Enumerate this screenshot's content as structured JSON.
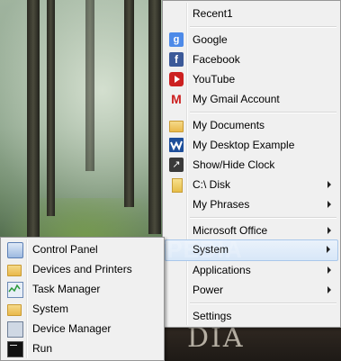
{
  "main_menu": {
    "items": [
      {
        "label": "Recent1",
        "icon": "",
        "submenu": false
      },
      {
        "label": "Google",
        "icon": "google-icon",
        "submenu": false
      },
      {
        "label": "Facebook",
        "icon": "facebook-icon",
        "submenu": false
      },
      {
        "label": "YouTube",
        "icon": "youtube-icon",
        "submenu": false
      },
      {
        "label": "My Gmail Account",
        "icon": "gmail-icon",
        "submenu": false
      },
      {
        "label": "My Documents",
        "icon": "folder-icon",
        "submenu": false
      },
      {
        "label": "My Desktop Example",
        "icon": "wave-icon",
        "submenu": false
      },
      {
        "label": "Show/Hide Clock",
        "icon": "shortcut-arrow-icon",
        "submenu": false
      },
      {
        "label": "C:\\ Disk",
        "icon": "disk-folder-icon",
        "submenu": true
      },
      {
        "label": "My Phrases",
        "icon": "",
        "submenu": true
      },
      {
        "label": "Microsoft Office",
        "icon": "",
        "submenu": true
      },
      {
        "label": "System",
        "icon": "",
        "submenu": true,
        "highlighted": true
      },
      {
        "label": "Applications",
        "icon": "",
        "submenu": true
      },
      {
        "label": "Power",
        "icon": "",
        "submenu": true
      },
      {
        "label": "Settings",
        "icon": "",
        "submenu": false
      }
    ]
  },
  "system_submenu": {
    "items": [
      {
        "label": "Control Panel",
        "icon": "control-panel-icon"
      },
      {
        "label": "Devices and Printers",
        "icon": "devices-printers-icon"
      },
      {
        "label": "Task Manager",
        "icon": "task-manager-icon"
      },
      {
        "label": "System",
        "icon": "system-icon"
      },
      {
        "label": "Device Manager",
        "icon": "device-manager-icon"
      },
      {
        "label": "Run",
        "icon": "run-icon"
      }
    ]
  },
  "background": {
    "watermark": "SOFTPEDIA",
    "bottom_text": "DIA"
  },
  "colors": {
    "menu_bg": "#f0f0f0",
    "menu_border": "#979797",
    "highlight": "#d8e7f8",
    "highlight_border": "#a9c7ea"
  }
}
